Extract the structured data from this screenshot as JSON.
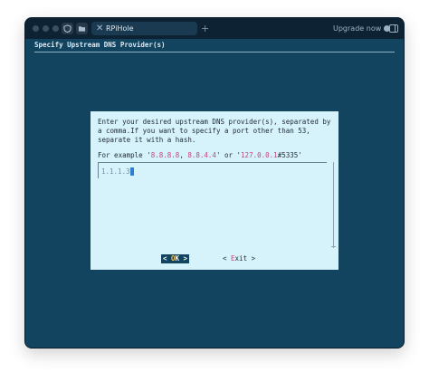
{
  "titlebar": {
    "tab_title": "RPiHole",
    "tab_close": "✕",
    "new_tab": "+",
    "upgrade_label": "Upgrade now"
  },
  "icons": {
    "window_controls": [
      "traffic-light-close",
      "traffic-light-minimize",
      "traffic-light-zoom"
    ],
    "toolbar": [
      "shield-icon",
      "folder-icon"
    ],
    "help": "question-circle-icon",
    "sidebar": "sidebar-toggle-icon"
  },
  "terminal": {
    "backtitle": "Specify Upstream DNS Provider(s)"
  },
  "dialog": {
    "prompt": "Enter your desired upstream DNS provider(s), separated by a comma.If you want to specify a port other than 53, separate it with a hash.",
    "example_prefix": "For example ",
    "example_q1": "'",
    "example_val1": "8.8.8.8",
    "example_sep": ", ",
    "example_val2": "8.8.4.4",
    "example_mid": "' or '",
    "example_val3": "127.0.0.1",
    "example_port": "#5335",
    "example_q2": "'",
    "input_value": "1.1.1.3",
    "ok_left": "< ",
    "ok_hot": "O",
    "ok_rest": "K",
    "ok_right": " >",
    "exit_left": "< ",
    "exit_hot": "E",
    "exit_rest": "xit",
    "exit_right": " >"
  },
  "colors": {
    "terminal_bg": "#12435f",
    "dialog_bg": "#d6f2fb",
    "accent_pink": "#c3457f",
    "ok_hotkey": "#f0c760",
    "cursor": "#2c7fd2"
  }
}
